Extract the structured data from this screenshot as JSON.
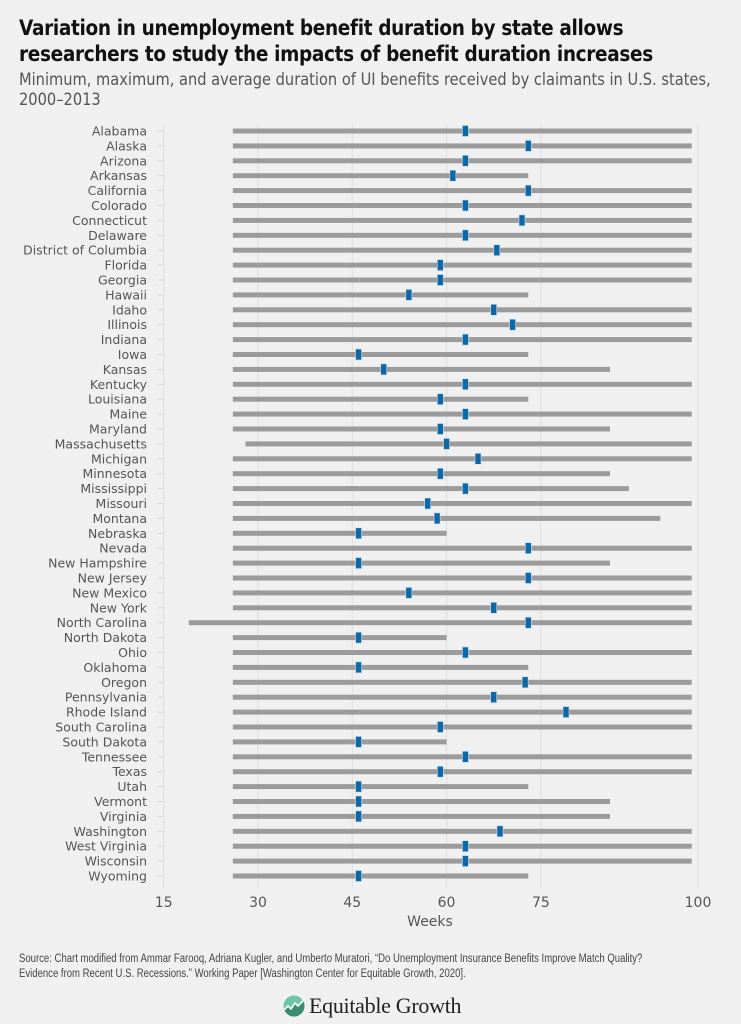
{
  "title": "Variation in unemployment benefit duration by state allows researchers to study the impacts of benefit duration increases",
  "subtitle": "Minimum, maximum, and average duration of UI benefits received by claimants in U.S. states, 2000–2013",
  "source": "Source: Chart modified from Ammar Farooq, Adriana Kugler, and Umberto Muratori, “Do Unemployment Insurance Benefits Improve Match Quality? Evidence from Recent U.S. Recessions.” Working Paper [Washington Center for Equitable Growth, 2020].",
  "logo": {
    "text": "Equitable Growth",
    "icon": "equitable-growth-logo-icon"
  },
  "colors": {
    "range_bar": "#9b9b9b",
    "average_marker": "#0d68a7",
    "gridline": "#dedede",
    "background": "#f0f0f0"
  },
  "chart_data": {
    "type": "range-dot",
    "title": "Variation in unemployment benefit duration by state allows researchers to study the impacts of benefit duration increases",
    "subtitle": "Minimum, maximum, and average duration of UI benefits received by claimants in U.S. states, 2000–2013",
    "xlabel": "Weeks",
    "ylabel": "",
    "xlim": [
      15,
      100
    ],
    "xticks": [
      15,
      30,
      45,
      60,
      75,
      100
    ],
    "grid": true,
    "legend": "none",
    "series_names": [
      "min",
      "max",
      "average"
    ],
    "categories": [
      "Alabama",
      "Alaska",
      "Arizona",
      "Arkansas",
      "California",
      "Colorado",
      "Connecticut",
      "Delaware",
      "District of Columbia",
      "Florida",
      "Georgia",
      "Hawaii",
      "Idaho",
      "Illinois",
      "Indiana",
      "Iowa",
      "Kansas",
      "Kentucky",
      "Louisiana",
      "Maine",
      "Maryland",
      "Massachusetts",
      "Michigan",
      "Minnesota",
      "Mississippi",
      "Missouri",
      "Montana",
      "Nebraska",
      "Nevada",
      "New Hampshire",
      "New Jersey",
      "New Mexico",
      "New York",
      "North Carolina",
      "North Dakota",
      "Ohio",
      "Oklahoma",
      "Oregon",
      "Pennsylvania",
      "Rhode Island",
      "South Carolina",
      "South Dakota",
      "Tennessee",
      "Texas",
      "Utah",
      "Vermont",
      "Virginia",
      "Washington",
      "West Virginia",
      "Wisconsin",
      "Wyoming"
    ],
    "min": [
      26,
      26,
      26,
      26,
      26,
      26,
      26,
      26,
      26,
      26,
      26,
      26,
      26,
      26,
      26,
      26,
      26,
      26,
      26,
      26,
      26,
      28,
      26,
      26,
      26,
      26,
      26,
      26,
      26,
      26,
      26,
      26,
      26,
      19,
      26,
      26,
      26,
      26,
      26,
      26,
      26,
      26,
      26,
      26,
      26,
      26,
      26,
      26,
      26,
      26,
      26
    ],
    "max": [
      99,
      99,
      99,
      73,
      99,
      99,
      99,
      99,
      99,
      99,
      99,
      73,
      99,
      99,
      99,
      73,
      86,
      99,
      73,
      99,
      86,
      99,
      99,
      86,
      89,
      99,
      94,
      60,
      99,
      86,
      99,
      99,
      99,
      99,
      60,
      99,
      73,
      99,
      99,
      99,
      99,
      60,
      99,
      99,
      73,
      86,
      86,
      99,
      99,
      99,
      73
    ],
    "average": [
      63,
      73,
      63,
      61,
      73,
      63,
      72,
      63,
      68,
      59,
      59,
      54,
      67.5,
      70.5,
      63,
      46,
      50,
      63,
      59,
      63,
      59,
      60,
      65,
      59,
      63,
      57,
      58.5,
      46,
      73,
      46,
      73,
      54,
      67.5,
      73,
      46,
      63,
      46,
      72.5,
      67.5,
      79,
      59,
      46,
      63,
      59,
      46,
      46,
      46,
      68.5,
      63,
      63,
      46
    ]
  }
}
